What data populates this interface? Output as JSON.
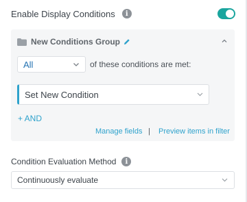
{
  "enable": {
    "label": "Enable Display Conditions",
    "toggle_on": true,
    "accent": "#1aa59e"
  },
  "group": {
    "title": "New Conditions Group",
    "match_select": {
      "value": "All"
    },
    "match_text": "of these conditions are met:",
    "condition_select": {
      "value": "Set New Condition"
    },
    "add_and": "+ AND",
    "manage_fields": "Manage fields",
    "separator": "|",
    "preview_items": "Preview items in filter"
  },
  "evaluation": {
    "label": "Condition Evaluation Method",
    "select": {
      "value": "Continuously evaluate"
    }
  },
  "icons": {
    "info": "info-icon",
    "folder": "folder-icon",
    "pencil": "pencil-icon",
    "chevron_up": "chevron-up-icon",
    "chevron_down": "chevron-down-icon"
  },
  "colors": {
    "link": "#2ea2cc",
    "select_all_text": "#2271b1",
    "group_bg": "#f5f6f7"
  }
}
